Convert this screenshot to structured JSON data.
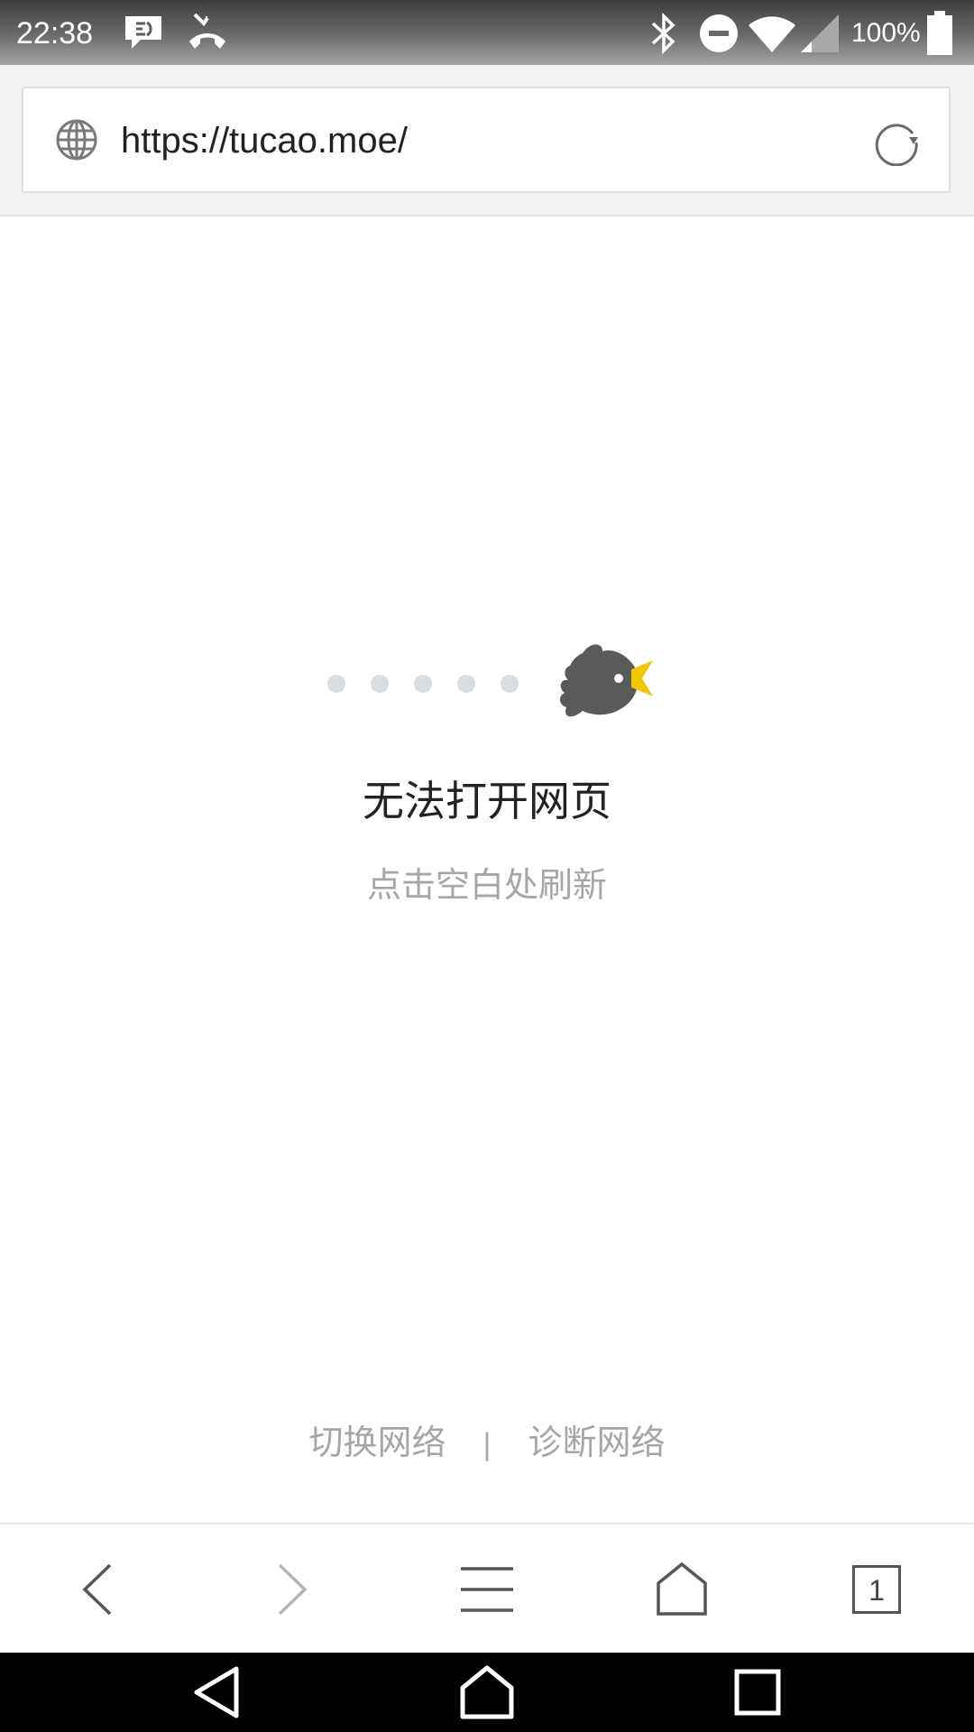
{
  "status_bar": {
    "time": "22:38",
    "battery_percent": "100%",
    "left_icons": [
      "message-notification-icon",
      "missed-call-icon"
    ],
    "right_icons": [
      "bluetooth-icon",
      "do-not-disturb-icon",
      "wifi-icon",
      "cell-signal-icon",
      "battery-icon"
    ],
    "battery_level": 1.0
  },
  "address_bar": {
    "url": "https://tucao.moe/",
    "left_icon": "globe-icon",
    "right_icon": "reload-icon"
  },
  "error_page": {
    "illustration": "bird-icon",
    "title": "无法打开网页",
    "subtitle": "点击空白处刷新",
    "links": {
      "switch_network": "切换网络",
      "separator": "|",
      "diagnose_network": "诊断网络"
    }
  },
  "browser_nav": {
    "buttons": [
      "back-icon",
      "forward-icon",
      "menu-icon",
      "home-icon",
      "tabs-icon"
    ],
    "tab_count": "1"
  },
  "system_nav": {
    "buttons": [
      "system-back-icon",
      "system-home-icon",
      "system-recents-icon"
    ]
  },
  "colors": {
    "bird_body": "#5a5a5a",
    "bird_beak": "#f5c400",
    "dots": "#d8dde2",
    "muted_text": "#a6a6a6"
  }
}
